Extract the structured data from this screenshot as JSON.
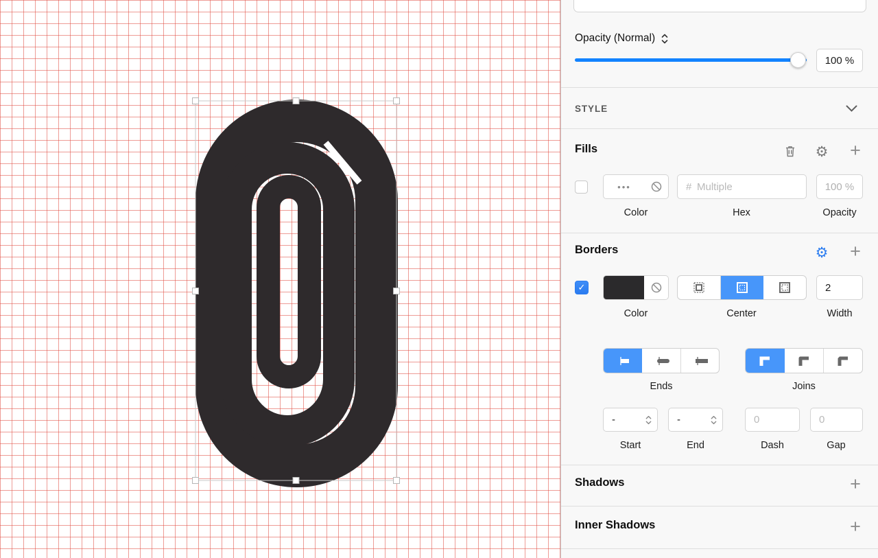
{
  "opacity": {
    "label": "Opacity (Normal)",
    "value": "100 %",
    "percent": 100
  },
  "style": {
    "header": "STYLE"
  },
  "fills": {
    "title": "Fills",
    "checkbox_checked": false,
    "color_dots": "•••",
    "hex_prefix": "#",
    "hex_placeholder": "Multiple",
    "opacity_value": "100 %",
    "labels": {
      "color": "Color",
      "hex": "Hex",
      "opacity": "Opacity"
    }
  },
  "borders": {
    "title": "Borders",
    "checkbox_checked": true,
    "check_glyph": "✓",
    "color_hex": "#2b2a2c",
    "position_selected": "Center",
    "width_value": "2",
    "labels": {
      "color": "Color",
      "position": "Center",
      "width": "Width"
    }
  },
  "stroke_options": {
    "ends_label": "Ends",
    "joins_label": "Joins",
    "start_value": "-",
    "end_value": "-",
    "dash_placeholder": "0",
    "gap_placeholder": "0",
    "labels": {
      "start": "Start",
      "end": "End",
      "dash": "Dash",
      "gap": "Gap"
    }
  },
  "shadows": {
    "title": "Shadows"
  },
  "inner_shadows": {
    "title": "Inner Shadows"
  },
  "glyphs": {
    "plus": "+",
    "gear": "⚙"
  },
  "colors": {
    "accent": "#1283ff",
    "selected_segment": "#4796fa",
    "grid": "#df4b3f",
    "logo": "#2e2a2c"
  }
}
